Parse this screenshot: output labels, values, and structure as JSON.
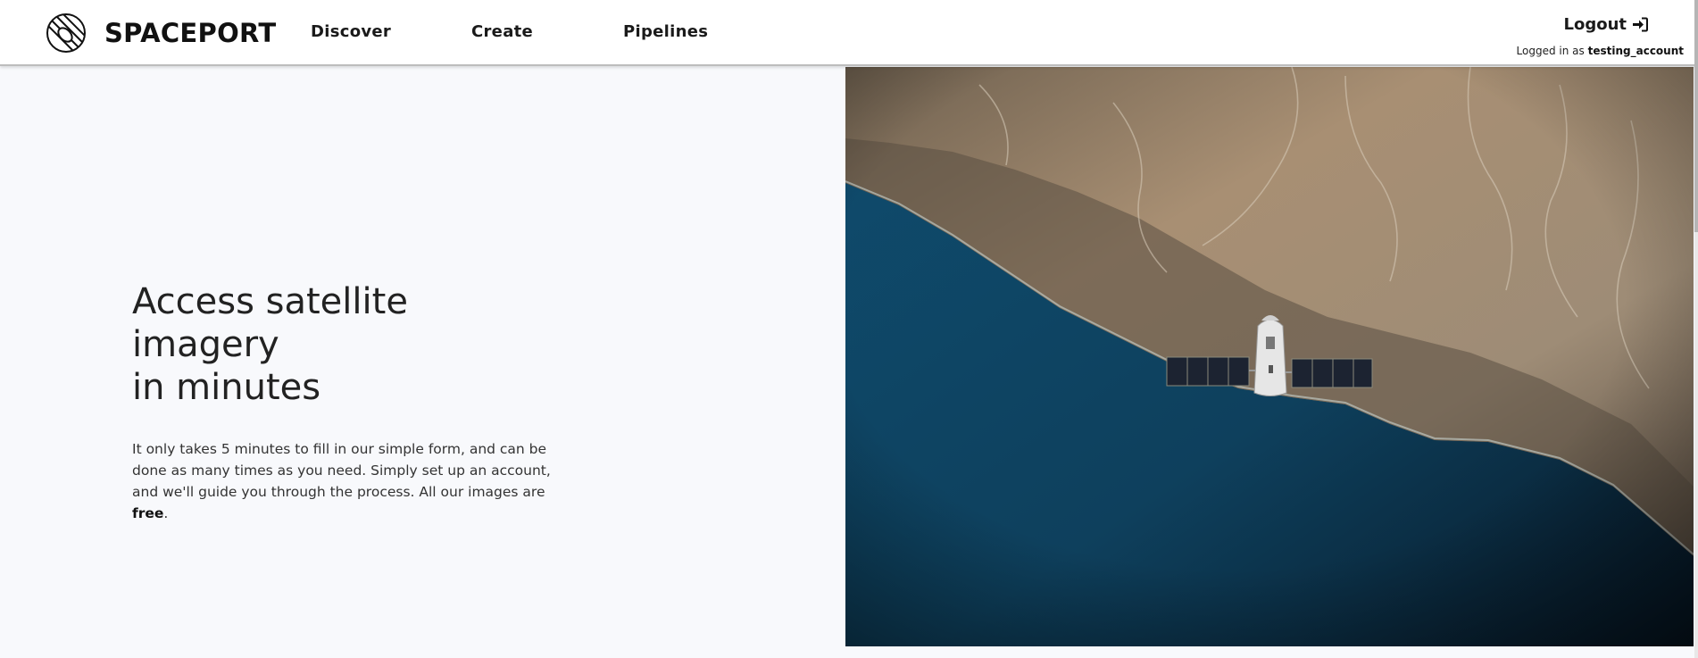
{
  "navbar": {
    "brand": {
      "name": "SPACEPORT",
      "logo_icon": "planet-logo-icon"
    },
    "links": [
      {
        "label": "Discover"
      },
      {
        "label": "Create"
      },
      {
        "label": "Pipelines"
      }
    ],
    "logout": {
      "label": "Logout",
      "icon": "sign-in-arrow-icon"
    },
    "login_status": {
      "prefix": "Logged in as",
      "username": "testing_account"
    }
  },
  "hero": {
    "title_line1": "Access satellite imagery",
    "title_line2": "in minutes",
    "body_text": "It only takes 5 minutes to fill in our simple form, and can be done as many times as you need. Simply set up an account, and we'll guide you through the process. All our images are ",
    "body_emphasis": "free",
    "body_end": ".",
    "image_icon": "satellite-over-coastline-image"
  },
  "colors": {
    "page_background": "#f8f9fc",
    "navbar_background": "#ffffff",
    "ocean": "#0f4c6e",
    "land": "#a58f74"
  }
}
